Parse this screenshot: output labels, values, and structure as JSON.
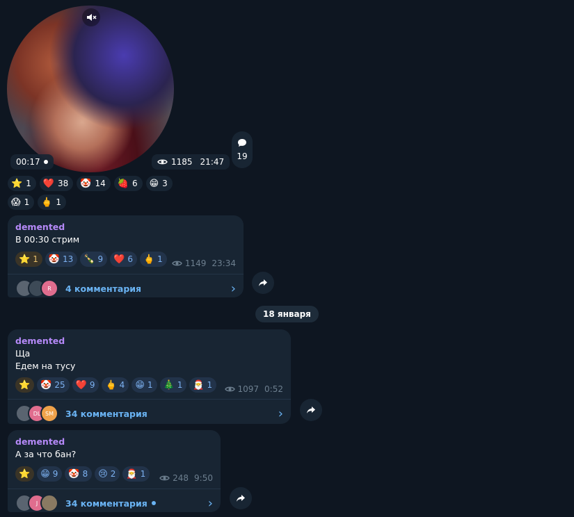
{
  "video": {
    "duration": "00:17",
    "views": "1185",
    "time": "21:47",
    "comments_count": "19",
    "reactions_row1": [
      {
        "icon": "⭐",
        "count": "1"
      },
      {
        "icon": "❤️",
        "count": "38"
      },
      {
        "icon": "🤡",
        "count": "14"
      },
      {
        "icon": "🍓",
        "count": "6"
      },
      {
        "icon": "😁",
        "count": "3"
      }
    ],
    "reactions_row2": [
      {
        "icon": "😱",
        "count": "1"
      },
      {
        "icon": "🖕",
        "count": "1"
      }
    ]
  },
  "messages": [
    {
      "author": "demented",
      "lines": [
        "В 00:30 стрим"
      ],
      "reactions": [
        {
          "icon": "⭐",
          "count": "1"
        },
        {
          "icon": "🤡",
          "count": "13"
        },
        {
          "icon": "🍾",
          "count": "9"
        },
        {
          "icon": "❤️",
          "count": "6"
        },
        {
          "icon": "🖕",
          "count": "1"
        }
      ],
      "views": "1149",
      "time": "23:34",
      "comments_label": "4 комментария",
      "avatars": [
        "",
        "",
        "R"
      ]
    },
    {
      "author": "demented",
      "lines": [
        "Ща",
        "Едем на тусу"
      ],
      "reactions": [
        {
          "icon": "⭐",
          "count": ""
        },
        {
          "icon": "🤡",
          "count": "25"
        },
        {
          "icon": "❤️",
          "count": "9"
        },
        {
          "icon": "🖕",
          "count": "4"
        },
        {
          "icon": "😁",
          "count": "1"
        },
        {
          "icon": "🎄",
          "count": "1"
        },
        {
          "icon": "🎅",
          "count": "1"
        }
      ],
      "views": "1097",
      "time": "0:52",
      "comments_label": "34 комментария",
      "avatars": [
        "",
        "DL",
        "SM"
      ]
    },
    {
      "author": "demented",
      "lines": [
        "А за что бан?"
      ],
      "reactions": [
        {
          "icon": "⭐",
          "count": ""
        },
        {
          "icon": "😁",
          "count": "9"
        },
        {
          "icon": "🤡",
          "count": "8"
        },
        {
          "icon": "😢",
          "count": "2"
        },
        {
          "icon": "🎅",
          "count": "1"
        }
      ],
      "views": "248",
      "time": "9:50",
      "comments_label": "34 комментария",
      "avatars": [
        "",
        "J",
        ""
      ]
    }
  ],
  "date_divider": "18 января",
  "colors": {
    "background": "#0e1621",
    "bubble": "#182533",
    "author": "#b589f8",
    "link": "#6ab3f3"
  }
}
